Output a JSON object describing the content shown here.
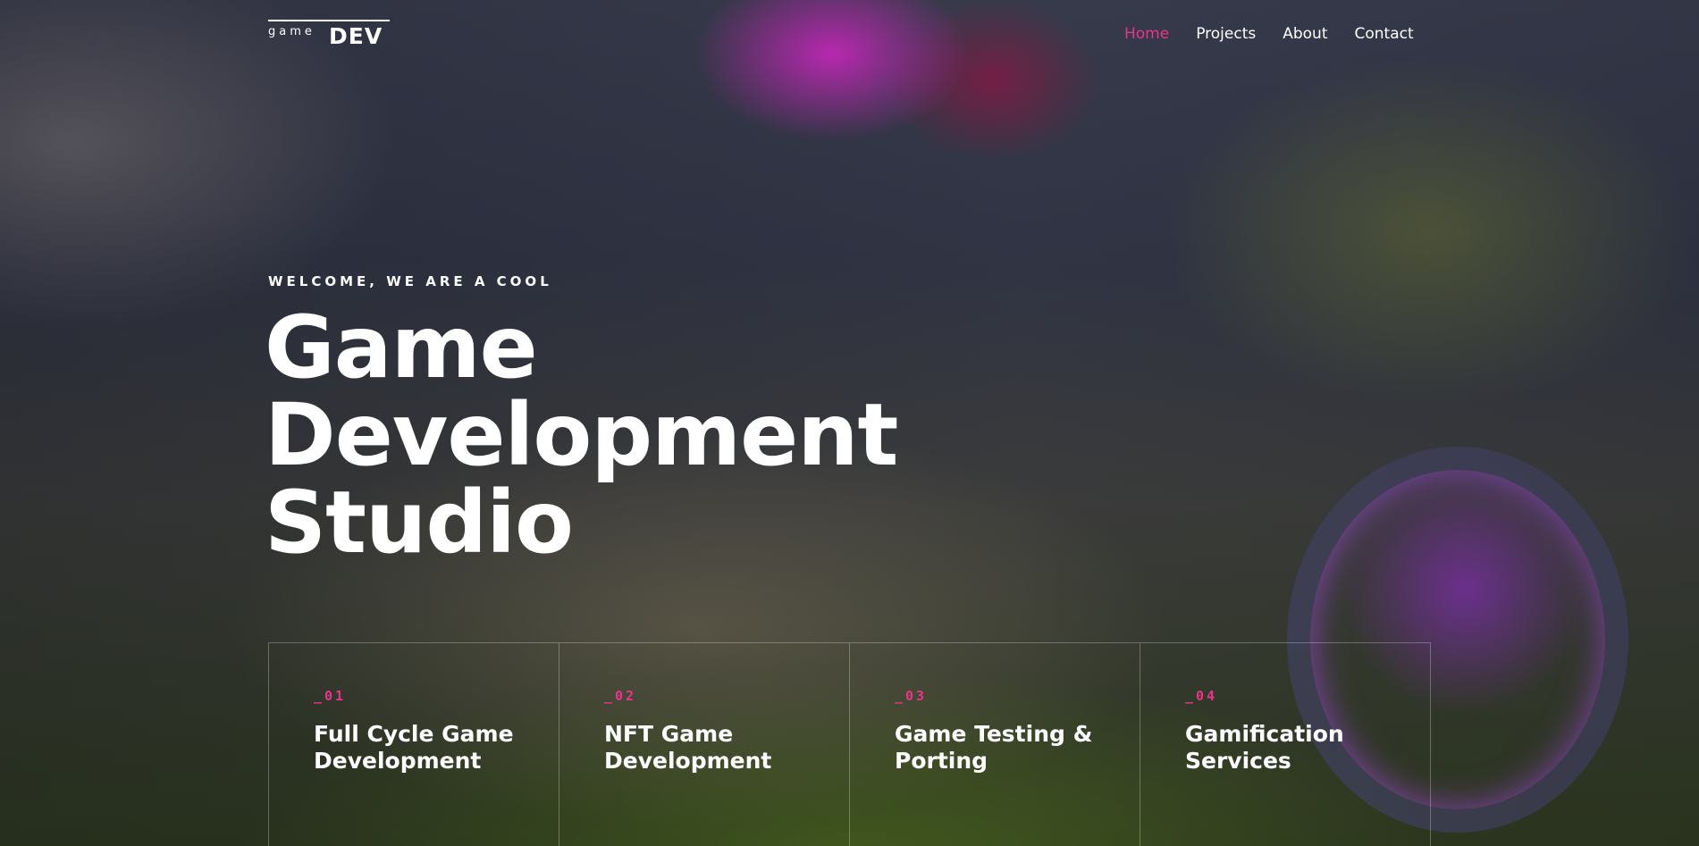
{
  "logo": {
    "small": "game",
    "big": "DEV"
  },
  "nav": {
    "items": [
      {
        "label": "Home",
        "active": true
      },
      {
        "label": "Projects",
        "active": false
      },
      {
        "label": "About",
        "active": false
      },
      {
        "label": "Contact",
        "active": false
      }
    ]
  },
  "hero": {
    "eyebrow": "WELCOME, WE ARE A COOL",
    "title_lines": [
      "Game",
      "Development",
      "Studio"
    ]
  },
  "services": [
    {
      "number": "_01",
      "title": "Full Cycle Game Development"
    },
    {
      "number": "_02",
      "title": "NFT Game Development"
    },
    {
      "number": "_03",
      "title": "Game Testing & Porting"
    },
    {
      "number": "_04",
      "title": "Gamification Services"
    }
  ],
  "colors": {
    "accent": "#e8358a",
    "text": "#ffffff"
  }
}
